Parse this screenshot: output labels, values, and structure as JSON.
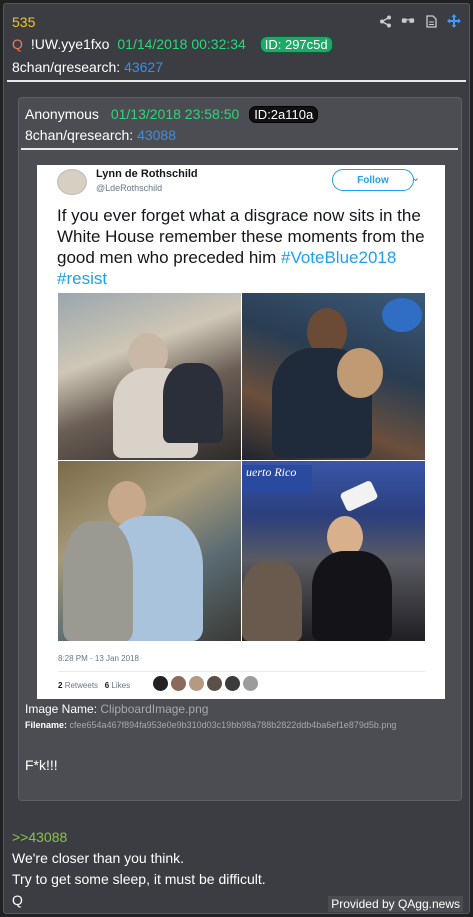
{
  "post": {
    "number": "535",
    "marker": "Q",
    "tripcode": "!UW.yye1fxo",
    "datetime": "01/14/2018 00:32:34",
    "id_label": "ID: 297c5d",
    "board": "8chan/qresearch:",
    "board_link": "43627",
    "reply_link": ">>43088",
    "lines": [
      "We're closer than you think.",
      "Try to get some sleep, it must be difficult.",
      "Q"
    ]
  },
  "toolbar": {
    "icons": [
      "share-icon",
      "glasses-icon",
      "document-icon",
      "move-icon"
    ]
  },
  "quoted": {
    "author": "Anonymous",
    "datetime": "01/13/2018 23:58:50",
    "id_label": "ID:2a110a",
    "board": "8chan/qresearch:",
    "board_link": "43088",
    "image_name_label": "Image Name:",
    "image_name": "ClipboardImage.png",
    "filename_label": "Filename:",
    "filename": "cfee654a467f894fa953e0e9b310d03c19bb98a788b2822ddb4ba6ef1e879d5b.png",
    "body": "F*k!!!"
  },
  "tweet": {
    "name": "Lynn de Rothschild",
    "handle": "@LdeRothschild",
    "follow": "Follow",
    "text": "If you ever forget what a disgrace now sits in the White House remember these moments from the good men who preceded him",
    "hashtags": "#VoteBlue2018 #resist",
    "time": "8:28 PM - 13 Jan 2018",
    "retweets_count": "2",
    "retweets_label": "Retweets",
    "likes_count": "6",
    "likes_label": "Likes",
    "photo_sign_text": "uerto Rico"
  },
  "footer": {
    "credit": "Provided by QAgg.news"
  },
  "colors": {
    "background": "#3b3d42",
    "post_number": "#f5c518",
    "date": "#27d97a",
    "link": "#3b8fe6",
    "reply": "#8bc34a",
    "hashtag": "#1da1f2"
  }
}
